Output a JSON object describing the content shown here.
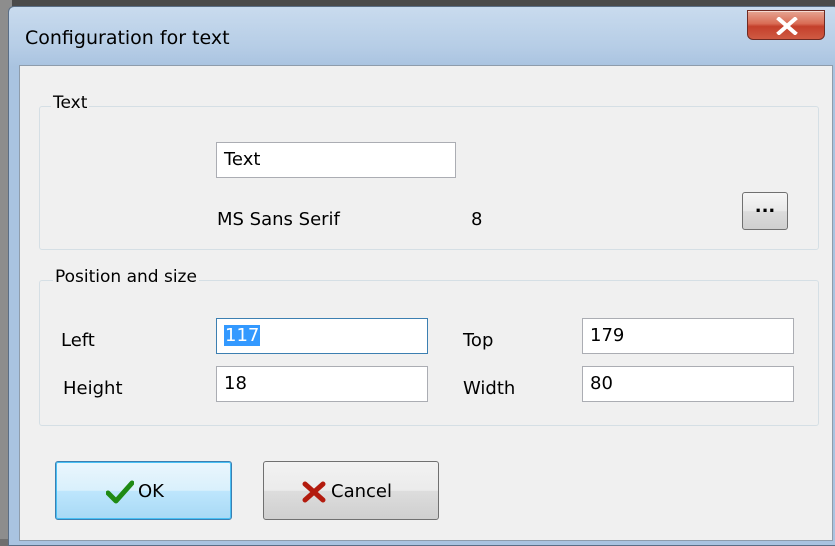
{
  "window": {
    "title": "Configuration for text",
    "close_icon": "close-x-icon"
  },
  "text_group": {
    "legend": "Text",
    "text_value": "Text",
    "font_name": "MS Sans Serif",
    "font_size": "8",
    "font_button_label": "..."
  },
  "position_group": {
    "legend": "Position and size",
    "left_label": "Left",
    "left_value": "117",
    "top_label": "Top",
    "top_value": "179",
    "height_label": "Height",
    "height_value": "18",
    "width_label": "Width",
    "width_value": "80"
  },
  "buttons": {
    "ok_label": "OK",
    "ok_icon": "checkmark-icon",
    "cancel_label": "Cancel",
    "cancel_icon": "x-cross-icon"
  },
  "colors": {
    "selection": "#3399ff",
    "ok_check": "#1f8a14",
    "cancel_x": "#b31b0e",
    "close_button": "#c4402b"
  }
}
